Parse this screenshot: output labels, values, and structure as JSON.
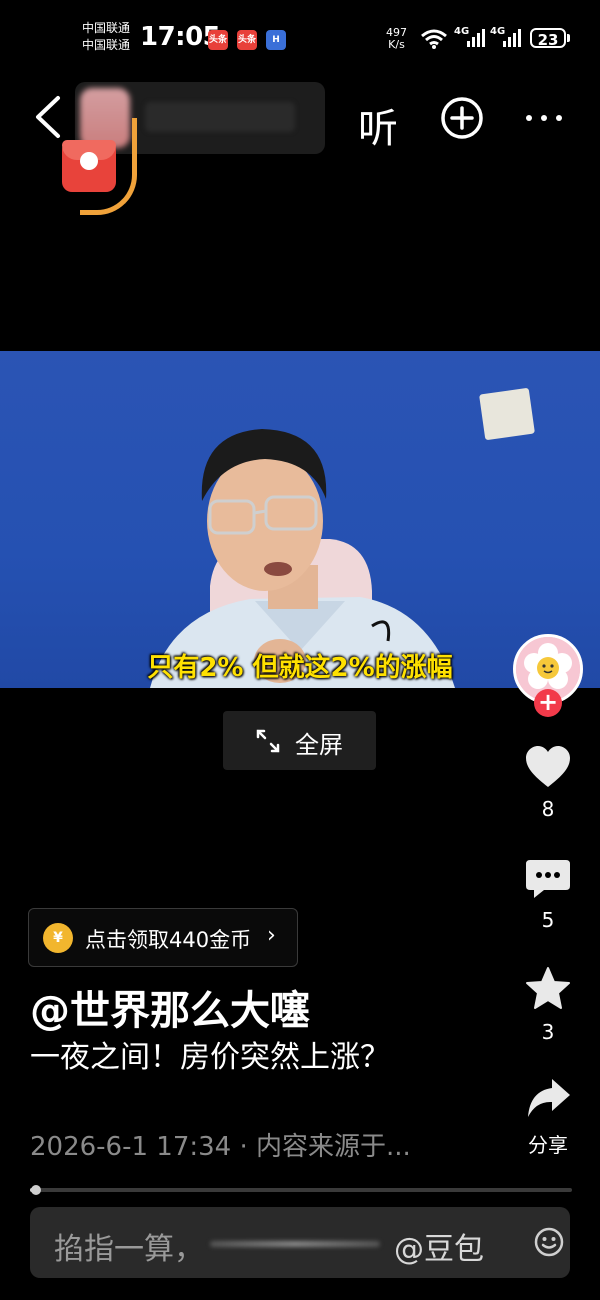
{
  "status_bar": {
    "carrier1": "中国联通",
    "carrier2": "中国联通",
    "time": "17:05",
    "app_badges": [
      "头条",
      "头条",
      "H"
    ],
    "net_speed_value": "497",
    "net_speed_unit": "K/s",
    "signal1": "4G",
    "signal2": "4G",
    "battery": "23"
  },
  "header": {
    "listen_label": "听"
  },
  "video": {
    "subtitle": "只有2% 但就这2%的涨幅",
    "fullscreen_label": "全屏"
  },
  "actions": {
    "likes": "8",
    "comments": "5",
    "favorites": "3",
    "share_label": "分享"
  },
  "post": {
    "coin_reward": "点击领取440金币",
    "coin_icon_char": "¥",
    "author": "@世界那么大噻",
    "title": "一夜之间！房价突然上涨？",
    "meta": "2026-6-1 17:34 · 内容来源于...",
    "progress_fraction": 0.01
  },
  "comment_bar": {
    "placeholder": "掐指一算，",
    "mention": "@豆包"
  },
  "colors": {
    "background": "#000000",
    "subtitle_yellow": "#ffe100",
    "video_blue": "#2551b2",
    "follow_red": "#f23a4a",
    "coin_gold": "#f2b62e"
  }
}
